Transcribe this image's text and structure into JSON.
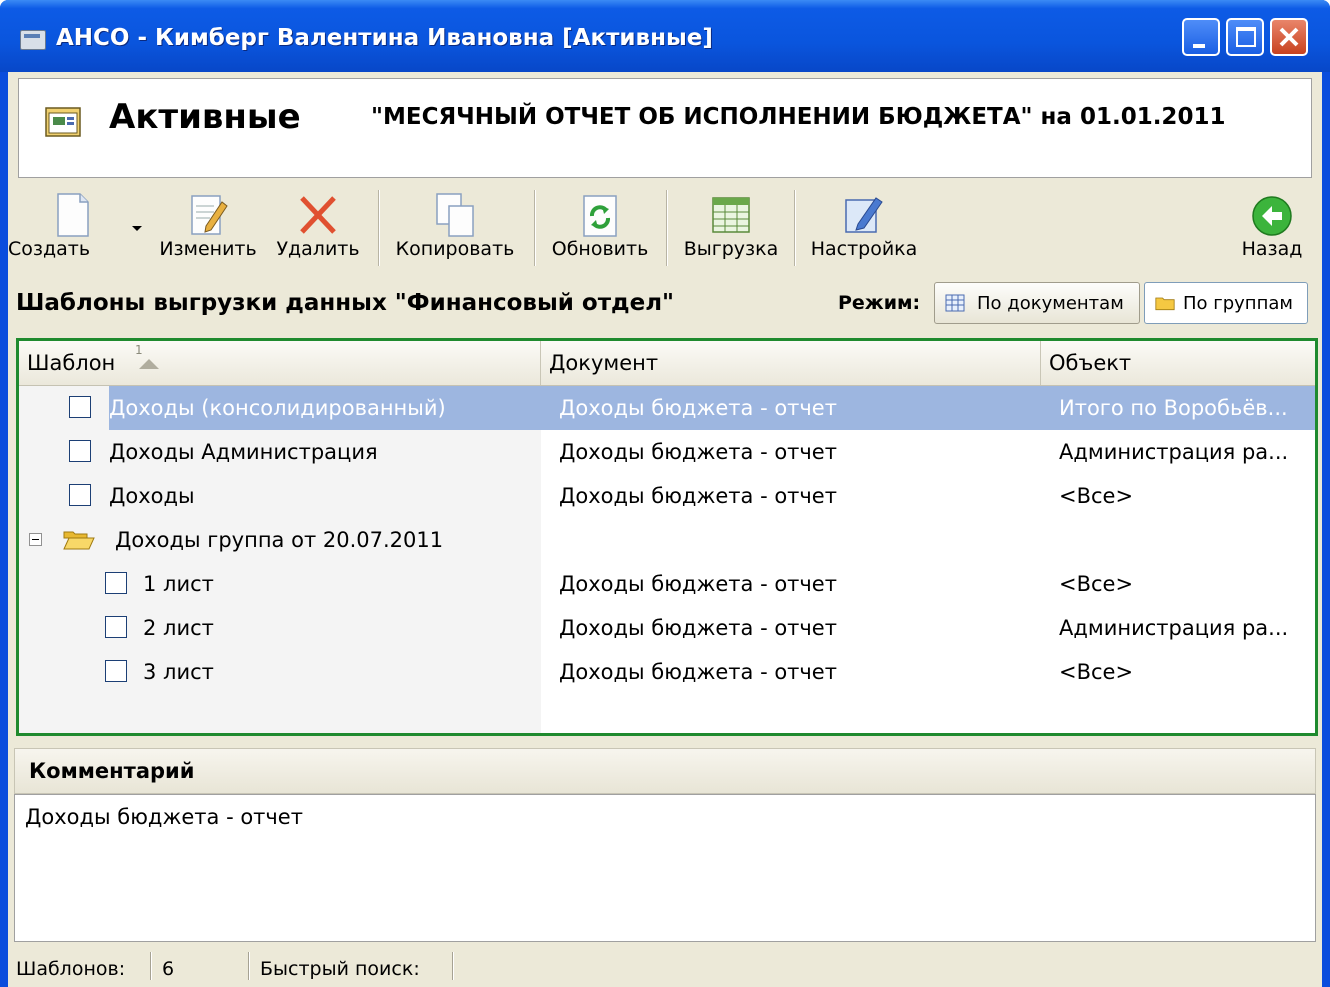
{
  "window": {
    "title": "АНСО - Кимберг Валентина Ивановна [Активные]",
    "buttons": {
      "minimize": "minimize-icon",
      "maximize": "maximize-icon",
      "close": "close-icon"
    }
  },
  "header": {
    "title": "Активные",
    "subtitle": "\"МЕСЯЧНЫЙ ОТЧЕТ ОБ ИСПОЛНЕНИИ БЮДЖЕТА\"  на 01.01.2011"
  },
  "toolbar": {
    "create": "Создать",
    "edit": "Изменить",
    "delete": "Удалить",
    "copy": "Копировать",
    "refresh": "Обновить",
    "export": "Выгрузка",
    "settings": "Настройка",
    "back": "Назад"
  },
  "subheader": {
    "title": "Шаблоны выгрузки данных \"Финансовый отдел\"",
    "mode_label": "Режим:",
    "mode_documents": "По документам",
    "mode_groups": "По группам",
    "active_mode": "По группам"
  },
  "grid": {
    "columns": {
      "template": "Шаблон",
      "sort_index": "1",
      "document": "Документ",
      "object": "Объект"
    },
    "rows": [
      {
        "name": "Доходы (консолидированный)",
        "document": "Доходы бюджета - отчет",
        "object": "Итого по Воробьёв...",
        "selected": true
      },
      {
        "name": "Доходы Администрация",
        "document": "Доходы бюджета - отчет",
        "object": "Администрация ра..."
      },
      {
        "name": "Доходы",
        "document": "Доходы бюджета - отчет",
        "object": "<Все>"
      },
      {
        "name": "Доходы группа от 20.07.2011",
        "document": "",
        "object": "",
        "group": true,
        "expanded": true
      },
      {
        "name": "1 лист",
        "document": "Доходы бюджета - отчет",
        "object": "<Все>"
      },
      {
        "name": "2 лист",
        "document": "Доходы бюджета - отчет",
        "object": "Администрация ра..."
      },
      {
        "name": "3 лист",
        "document": "Доходы бюджета - отчет",
        "object": "<Все>"
      }
    ]
  },
  "comment": {
    "title": "Комментарий",
    "text": "Доходы бюджета - отчет"
  },
  "status": {
    "count_label": "Шаблонов:",
    "count_value": "6",
    "search_label": "Быстрый поиск:",
    "search_value": ""
  },
  "colors": {
    "titlebar": "#0a55dd",
    "grid_border": "#1f8a2e",
    "selection": "#9db6e0"
  }
}
